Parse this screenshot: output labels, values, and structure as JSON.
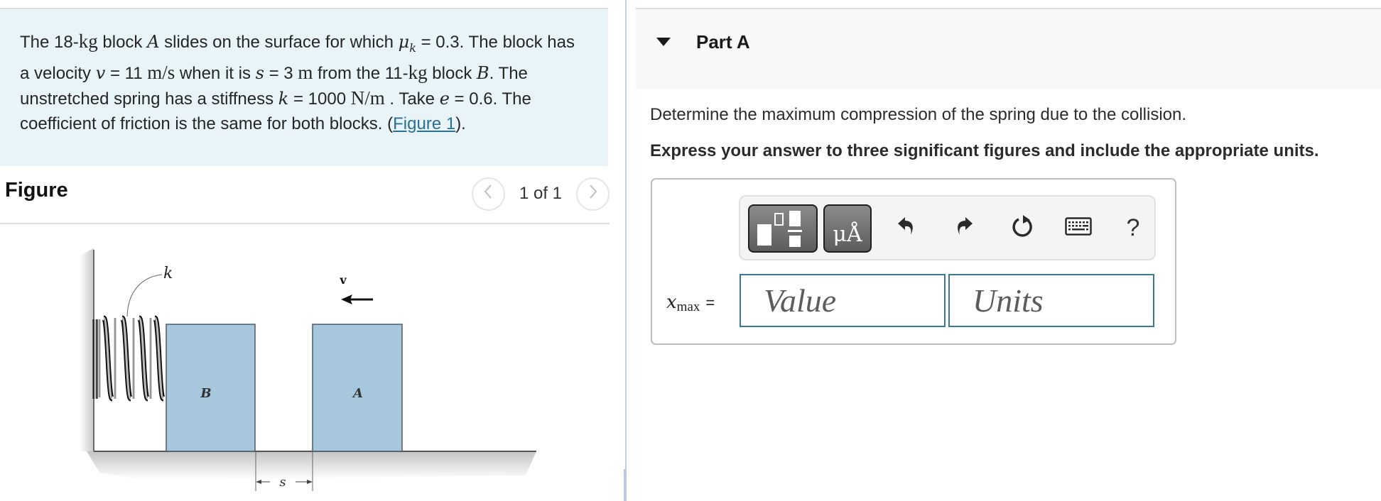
{
  "problem": {
    "segments": [
      {
        "t": "text",
        "v": "The 18-"
      },
      {
        "t": "unit",
        "v": "kg"
      },
      {
        "t": "text",
        "v": " block "
      },
      {
        "t": "math",
        "v": "A"
      },
      {
        "t": "text",
        "v": " slides on the surface for which "
      },
      {
        "t": "math",
        "v": "μ"
      },
      {
        "t": "sub",
        "v": "k"
      },
      {
        "t": "text",
        "v": " = 0.3. The block has a velocity "
      },
      {
        "t": "math",
        "v": "v"
      },
      {
        "t": "text",
        "v": " = 11  "
      },
      {
        "t": "unit",
        "v": "m/s"
      },
      {
        "t": "text",
        "v": " when it is "
      },
      {
        "t": "math",
        "v": "s"
      },
      {
        "t": "text",
        "v": " = 3  "
      },
      {
        "t": "unit",
        "v": "m"
      },
      {
        "t": "text",
        "v": " from the 11-"
      },
      {
        "t": "unit",
        "v": "kg"
      },
      {
        "t": "text",
        "v": " block "
      },
      {
        "t": "math",
        "v": "B"
      },
      {
        "t": "text",
        "v": ". The unstretched spring has a stiffness "
      },
      {
        "t": "math",
        "v": "k"
      },
      {
        "t": "text",
        "v": " = 1000  "
      },
      {
        "t": "unit",
        "v": "N/m"
      },
      {
        "t": "text",
        "v": " . Take "
      },
      {
        "t": "math",
        "v": "e"
      },
      {
        "t": "text",
        "v": " = 0.6. The coefficient of friction is the same for both blocks. ("
      },
      {
        "t": "link",
        "v": "Figure 1"
      },
      {
        "t": "text",
        "v": ")."
      }
    ]
  },
  "figure": {
    "title": "Figure",
    "pager_text": "1 of 1",
    "prev_icon": "chevron-left-icon",
    "next_icon": "chevron-right-icon",
    "labels": {
      "k": "k",
      "v": "v",
      "block_b": "B",
      "block_a": "A",
      "s": "s"
    },
    "colors": {
      "block": "#a6c7dc",
      "block_border": "#4a5c6a",
      "ground_shadow": "#cfcfcf"
    }
  },
  "part": {
    "title": "Part A",
    "collapse_icon": "caret-down-icon",
    "question": "Determine the maximum compression of the spring due to the collision.",
    "instruction": "Express your answer to three significant figures and include the appropriate units.",
    "toolbar": {
      "templates_icon": "fraction-template-icon",
      "units_label": "μÅ",
      "undo_icon": "undo-icon",
      "redo_icon": "redo-icon",
      "reset_icon": "reset-icon",
      "keyboard_icon": "keyboard-icon",
      "help_label": "?"
    },
    "answer": {
      "var": "x",
      "sub": "max",
      "eq": "=",
      "value_placeholder": "Value",
      "value": "",
      "units_placeholder": "Units",
      "units": ""
    }
  }
}
